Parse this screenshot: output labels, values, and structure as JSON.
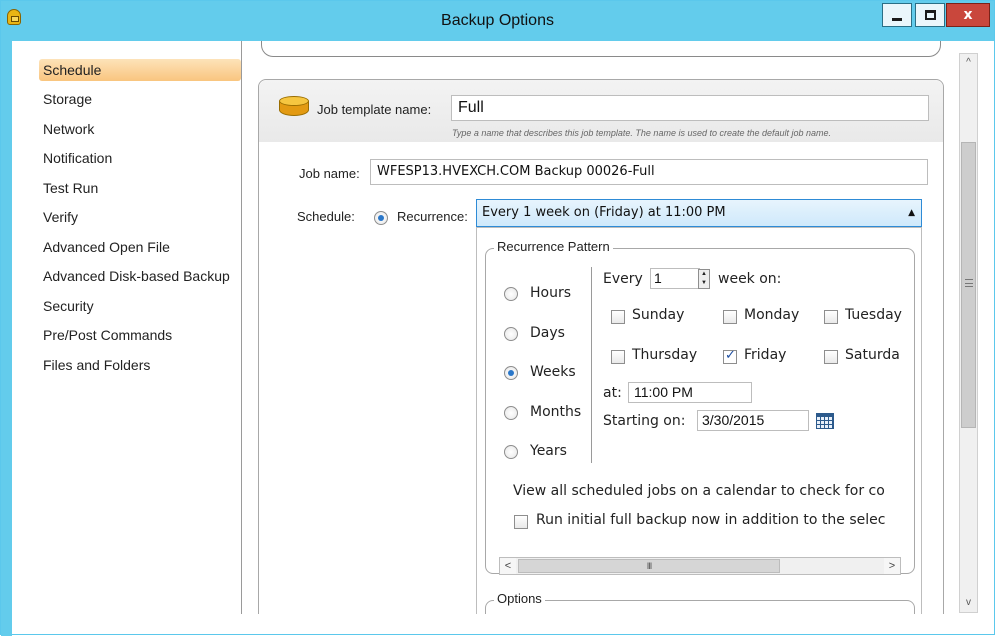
{
  "window": {
    "title": "Backup Options",
    "close_glyph": "x"
  },
  "sidebar": {
    "items": [
      {
        "label": "Schedule",
        "active": true
      },
      {
        "label": "Storage"
      },
      {
        "label": "Network"
      },
      {
        "label": "Notification"
      },
      {
        "label": "Test Run"
      },
      {
        "label": "Verify"
      },
      {
        "label": "Advanced Open File"
      },
      {
        "label": "Advanced Disk-based Backup"
      },
      {
        "label": "Security"
      },
      {
        "label": "Pre/Post Commands"
      },
      {
        "label": "Files and Folders"
      }
    ]
  },
  "template": {
    "label": "Job template name:",
    "value": "Full",
    "hint": "Type a name that describes this job template. The name is used to create the default job name."
  },
  "job": {
    "label": "Job name:",
    "value": "WFESP13.HVEXCH.COM Backup 00026-Full"
  },
  "schedule": {
    "label": "Schedule:",
    "recurrence_label": "Recurrence:",
    "recurrence_value": "Every 1 week on (Friday) at 11:00 PM"
  },
  "pattern": {
    "title": "Recurrence Pattern",
    "units": [
      {
        "label": "Hours",
        "selected": false
      },
      {
        "label": "Days",
        "selected": false
      },
      {
        "label": "Weeks",
        "selected": true
      },
      {
        "label": "Months",
        "selected": false
      },
      {
        "label": "Years",
        "selected": false
      }
    ],
    "every_label": "Every",
    "every_value": "1",
    "week_on_label": "week on:",
    "days": [
      {
        "label": "Sunday",
        "checked": false
      },
      {
        "label": "Monday",
        "checked": false
      },
      {
        "label": "Tuesday",
        "checked": false
      },
      {
        "label": "Thursday",
        "checked": false
      },
      {
        "label": "Friday",
        "checked": true
      },
      {
        "label": "Saturda",
        "checked": false
      }
    ],
    "at_label": "at:",
    "at_value": "11:00 PM",
    "starting_label": "Starting on:",
    "starting_value": "3/30/2015"
  },
  "calendar_link": "View all scheduled jobs on a calendar to check for co",
  "initial_backup_label": "Run initial full backup now in addition to the selec",
  "options_title": "Options",
  "scroll": {
    "h_left": "<",
    "h_right": ">",
    "h_grip": "III",
    "v_up": "^",
    "v_down": "v"
  }
}
